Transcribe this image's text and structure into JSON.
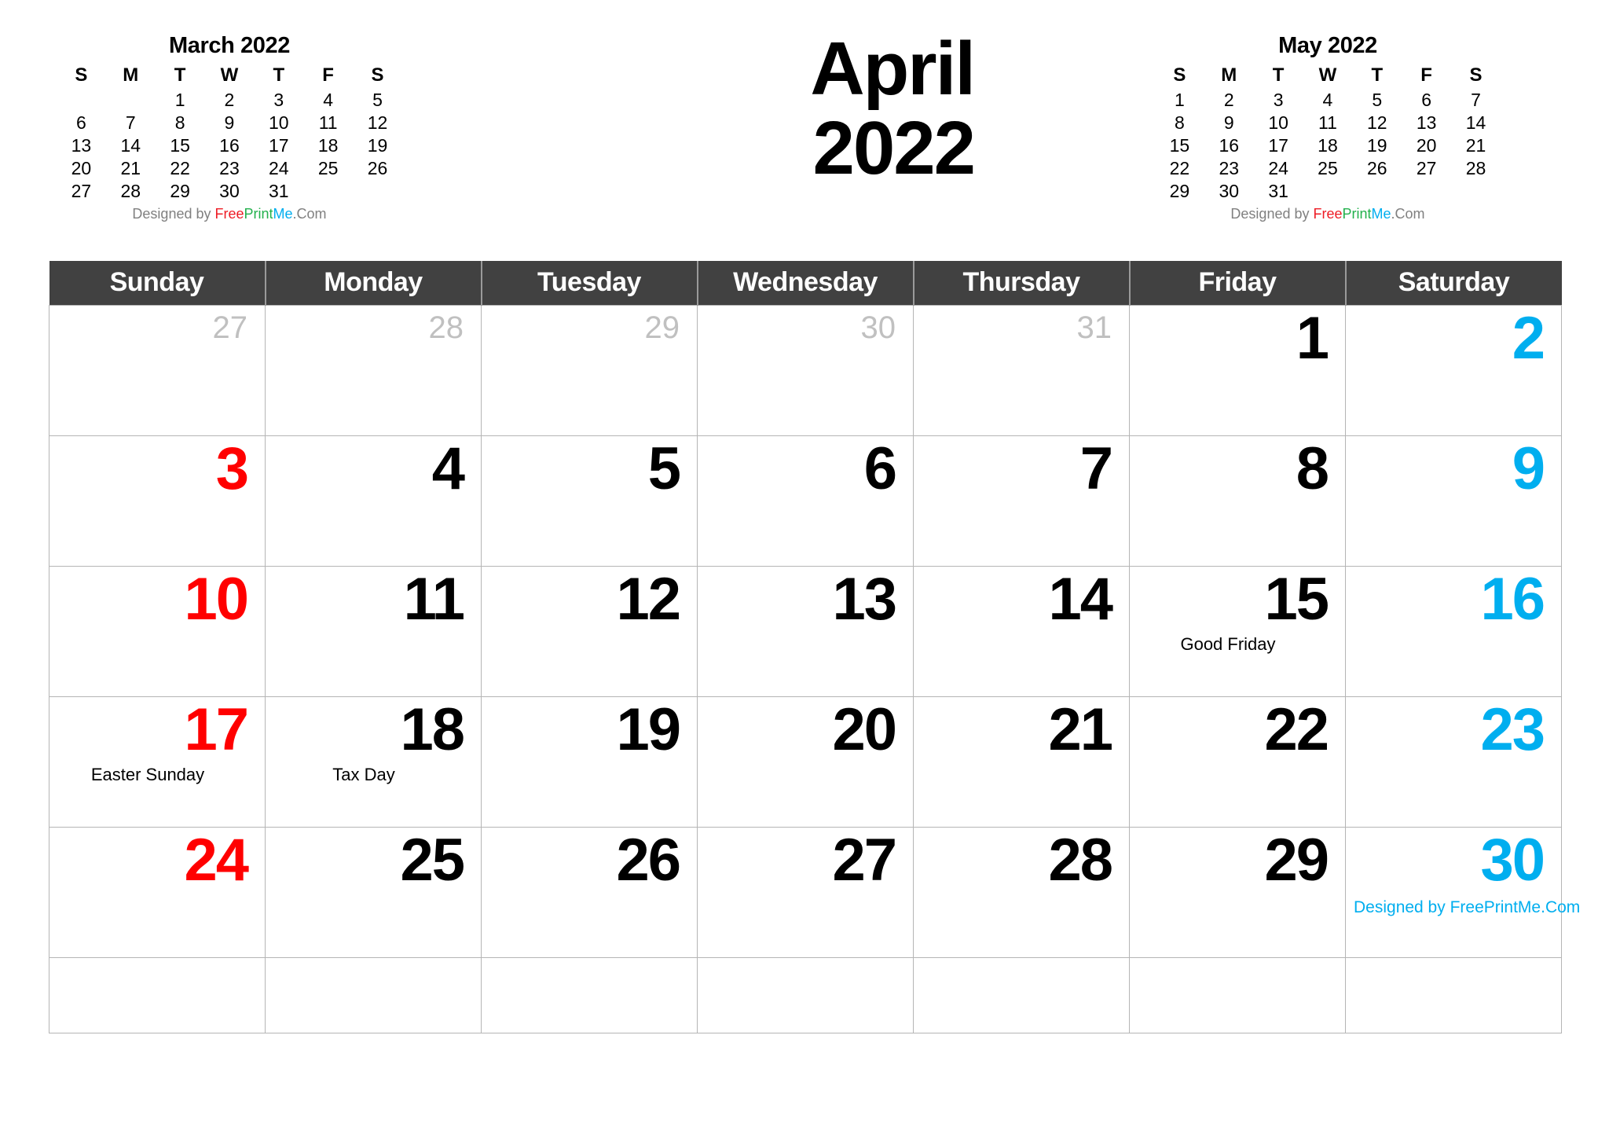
{
  "title": {
    "month": "April",
    "year": "2022"
  },
  "colors": {
    "sunday": "#FF0000",
    "saturday": "#00AEEF",
    "weekday": "#000000",
    "other_month": "#C0C0C0",
    "header_bg": "#414141",
    "header_text": "#FFFFFF",
    "grid_line": "#B5B5B5"
  },
  "credit": {
    "designed_by": "Designed by ",
    "free": "Free",
    "print": "Print",
    "me": "Me",
    "dotcom": ".Com",
    "full": "Designed by FreePrintMe.Com"
  },
  "mini_left": {
    "title": "March 2022",
    "weekdays": [
      "S",
      "M",
      "T",
      "W",
      "T",
      "F",
      "S"
    ],
    "weeks": [
      [
        "",
        "",
        "1",
        "2",
        "3",
        "4",
        "5"
      ],
      [
        "6",
        "7",
        "8",
        "9",
        "10",
        "11",
        "12"
      ],
      [
        "13",
        "14",
        "15",
        "16",
        "17",
        "18",
        "19"
      ],
      [
        "20",
        "21",
        "22",
        "23",
        "24",
        "25",
        "26"
      ],
      [
        "27",
        "28",
        "29",
        "30",
        "31",
        "",
        ""
      ]
    ]
  },
  "mini_right": {
    "title": "May 2022",
    "weekdays": [
      "S",
      "M",
      "T",
      "W",
      "T",
      "F",
      "S"
    ],
    "weeks": [
      [
        "1",
        "2",
        "3",
        "4",
        "5",
        "6",
        "7"
      ],
      [
        "8",
        "9",
        "10",
        "11",
        "12",
        "13",
        "14"
      ],
      [
        "15",
        "16",
        "17",
        "18",
        "19",
        "20",
        "21"
      ],
      [
        "22",
        "23",
        "24",
        "25",
        "26",
        "27",
        "28"
      ],
      [
        "29",
        "30",
        "31",
        "",
        "",
        "",
        ""
      ]
    ]
  },
  "main": {
    "weekday_headers": [
      "Sunday",
      "Monday",
      "Tuesday",
      "Wednesday",
      "Thursday",
      "Friday",
      "Saturday"
    ],
    "weeks": [
      [
        {
          "day": "27",
          "kind": "other"
        },
        {
          "day": "28",
          "kind": "other"
        },
        {
          "day": "29",
          "kind": "other"
        },
        {
          "day": "30",
          "kind": "other"
        },
        {
          "day": "31",
          "kind": "other"
        },
        {
          "day": "1",
          "kind": "weekday"
        },
        {
          "day": "2",
          "kind": "sat"
        }
      ],
      [
        {
          "day": "3",
          "kind": "sun"
        },
        {
          "day": "4",
          "kind": "weekday"
        },
        {
          "day": "5",
          "kind": "weekday"
        },
        {
          "day": "6",
          "kind": "weekday"
        },
        {
          "day": "7",
          "kind": "weekday"
        },
        {
          "day": "8",
          "kind": "weekday"
        },
        {
          "day": "9",
          "kind": "sat"
        }
      ],
      [
        {
          "day": "10",
          "kind": "sun"
        },
        {
          "day": "11",
          "kind": "weekday"
        },
        {
          "day": "12",
          "kind": "weekday"
        },
        {
          "day": "13",
          "kind": "weekday"
        },
        {
          "day": "14",
          "kind": "weekday"
        },
        {
          "day": "15",
          "kind": "weekday",
          "holiday": "Good Friday"
        },
        {
          "day": "16",
          "kind": "sat"
        }
      ],
      [
        {
          "day": "17",
          "kind": "sun",
          "holiday": "Easter Sunday"
        },
        {
          "day": "18",
          "kind": "weekday",
          "holiday": "Tax Day"
        },
        {
          "day": "19",
          "kind": "weekday"
        },
        {
          "day": "20",
          "kind": "weekday"
        },
        {
          "day": "21",
          "kind": "weekday"
        },
        {
          "day": "22",
          "kind": "weekday"
        },
        {
          "day": "23",
          "kind": "sat"
        }
      ],
      [
        {
          "day": "24",
          "kind": "sun"
        },
        {
          "day": "25",
          "kind": "weekday"
        },
        {
          "day": "26",
          "kind": "weekday"
        },
        {
          "day": "27",
          "kind": "weekday"
        },
        {
          "day": "28",
          "kind": "weekday"
        },
        {
          "day": "29",
          "kind": "weekday"
        },
        {
          "day": "30",
          "kind": "sat",
          "credit": "Designed by FreePrintMe.Com"
        }
      ],
      [
        {
          "day": "",
          "kind": "empty"
        },
        {
          "day": "",
          "kind": "empty"
        },
        {
          "day": "",
          "kind": "empty"
        },
        {
          "day": "",
          "kind": "empty"
        },
        {
          "day": "",
          "kind": "empty"
        },
        {
          "day": "",
          "kind": "empty"
        },
        {
          "day": "",
          "kind": "empty"
        }
      ]
    ]
  }
}
